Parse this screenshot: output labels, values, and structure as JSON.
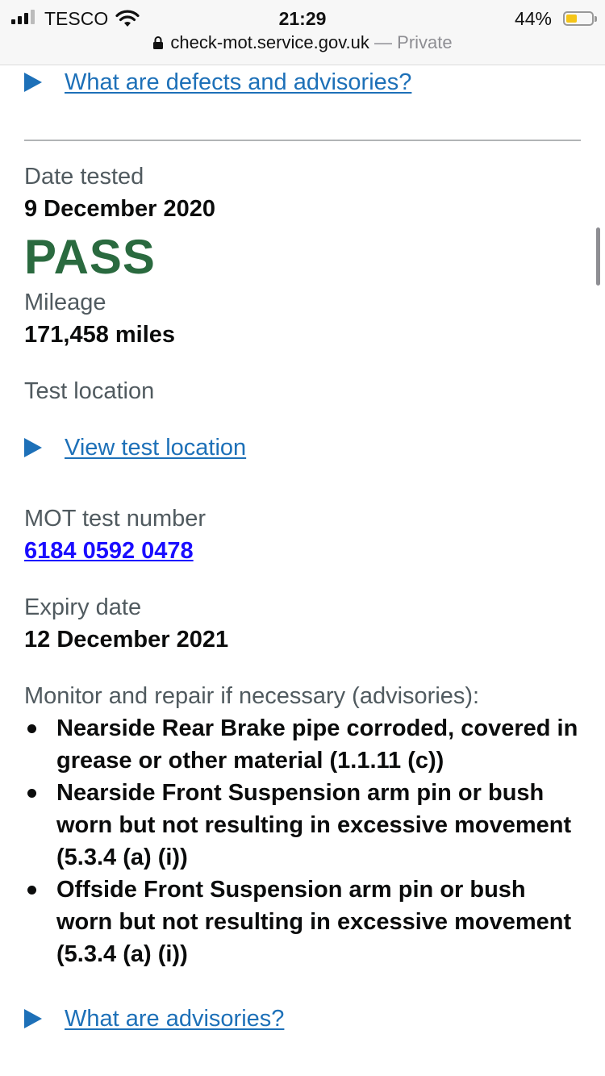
{
  "status_bar": {
    "carrier": "TESCO",
    "time": "21:29",
    "battery": "44%",
    "battery_level": 0.44,
    "url": "check-mot.service.gov.uk",
    "separator": "—",
    "private_label": "Private"
  },
  "colors": {
    "link": "#1d70b8",
    "pass": "#2a6a3f",
    "test_number_link": "#1a0dff",
    "label": "#505a5f"
  },
  "defects_link": "What are defects and advisories?",
  "test": {
    "date_label": "Date tested",
    "date": "9 December 2020",
    "result": "PASS",
    "mileage_label": "Mileage",
    "mileage": "171,458 miles",
    "location_label": "Test location",
    "location_link": "View test location",
    "number_label": "MOT test number",
    "number": "6184 0592 0478",
    "expiry_label": "Expiry date",
    "expiry": "12 December 2021",
    "advisories_label": "Monitor and repair if necessary (advisories):",
    "advisories": [
      "Nearside Rear Brake pipe corroded, covered in grease or other material (1.1.11 (c))",
      "Nearside Front Suspension arm pin or bush worn but not resulting in excessive movement (5.3.4 (a) (i))",
      "Offside Front Suspension arm pin or bush worn but not resulting in excessive movement (5.3.4 (a) (i))"
    ],
    "advisories_link": "What are advisories?"
  }
}
